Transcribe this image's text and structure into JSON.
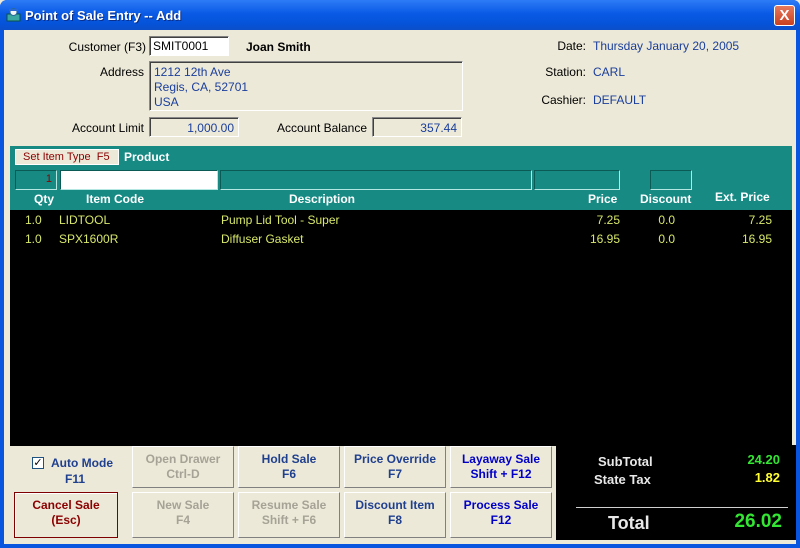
{
  "window": {
    "title": "Point of Sale Entry -- Add",
    "close_label": "X"
  },
  "customer": {
    "label": "Customer (F3)",
    "code": "SMIT0001",
    "name": "Joan Smith",
    "address_label": "Address",
    "address_lines": [
      "1212 12th Ave",
      "Regis, CA, 52701",
      "USA"
    ],
    "account_limit_label": "Account Limit",
    "account_limit": "1,000.00",
    "account_balance_label": "Account Balance",
    "account_balance": "357.44"
  },
  "session": {
    "date_label": "Date:",
    "date": "Thursday January 20, 2005",
    "station_label": "Station:",
    "station": "CARL",
    "cashier_label": "Cashier:",
    "cashier": "DEFAULT"
  },
  "entry": {
    "set_item_type_label": "Set Item Type",
    "set_item_type_key": "F5",
    "item_type": "Product",
    "qty_value": "1"
  },
  "grid": {
    "columns": [
      "Qty",
      "Item Code",
      "Description",
      "Price",
      "Discount",
      "Ext. Price"
    ],
    "rows": [
      {
        "qty": "1.0",
        "code": "LIDTOOL",
        "description": "Pump Lid Tool - Super",
        "price": "7.25",
        "discount": "0.0",
        "ext": "7.25"
      },
      {
        "qty": "1.0",
        "code": "SPX1600R",
        "description": "Diffuser Gasket",
        "price": "16.95",
        "discount": "0.0",
        "ext": "16.95"
      }
    ]
  },
  "buttons": {
    "auto_mode": {
      "label": "Auto Mode",
      "key": "F11",
      "checked": true
    },
    "open_drawer": {
      "label": "Open Drawer",
      "key": "Ctrl-D"
    },
    "hold_sale": {
      "label": "Hold Sale",
      "key": "F6"
    },
    "price_override": {
      "label": "Price Override",
      "key": "F7"
    },
    "layaway_sale": {
      "label": "Layaway Sale",
      "key": "Shift + F12"
    },
    "cancel_sale": {
      "label": "Cancel Sale",
      "key": "(Esc)"
    },
    "new_sale": {
      "label": "New Sale",
      "key": "F4"
    },
    "resume_sale": {
      "label": "Resume Sale",
      "key": "Shift + F6"
    },
    "discount_item": {
      "label": "Discount Item",
      "key": "F8"
    },
    "process_sale": {
      "label": "Process Sale",
      "key": "F12"
    }
  },
  "totals": {
    "subtotal_label": "SubTotal",
    "subtotal": "24.20",
    "tax_label": "State Tax",
    "tax": "1.82",
    "total_label": "Total",
    "total": "26.02"
  },
  "colors": {
    "grid_header": "#178a84",
    "row_text": "#d8e86a",
    "total_green": "#33e633",
    "tax_yellow": "#ffff33"
  }
}
